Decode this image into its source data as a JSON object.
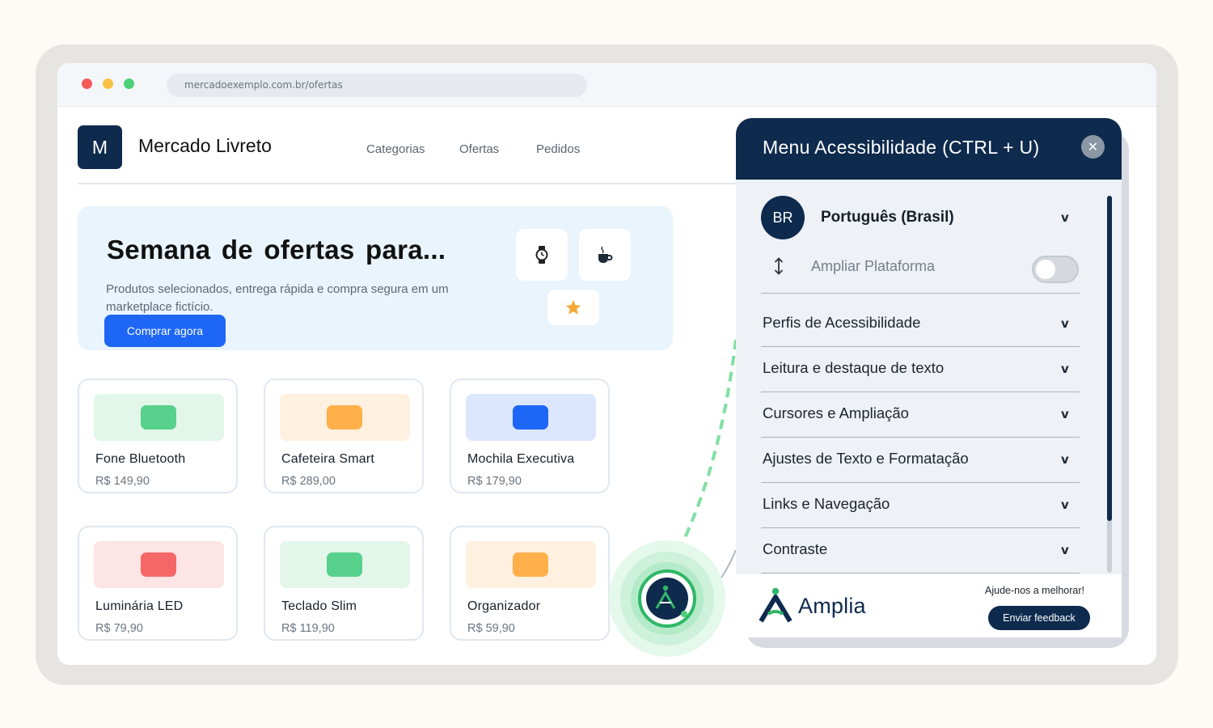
{
  "browser": {
    "url": "mercadoexemplo.com.br/ofertas"
  },
  "site": {
    "logo_letter": "M",
    "brand_name": "Mercado Livreto",
    "nav": [
      "Categorias",
      "Ofertas",
      "Pedidos"
    ]
  },
  "hero": {
    "title": "Semana de ofertas para...",
    "subtitle": "Produtos selecionados, entrega rápida e compra segura em um marketplace fictício.",
    "cta_label": "Comprar agora",
    "tiles": [
      "watch-icon",
      "coffee-icon",
      "star-icon"
    ]
  },
  "products": [
    {
      "name": "Fone Bluetooth",
      "price": "R$ 149,90",
      "thumb_color": "#e2f6ea",
      "chip_color": "#57d18c"
    },
    {
      "name": "Cafeteira Smart",
      "price": "R$ 289,00",
      "thumb_color": "#fff0df",
      "chip_color": "#ffb04a"
    },
    {
      "name": "Mochila Executiva",
      "price": "R$ 179,90",
      "thumb_color": "#dce7fd",
      "chip_color": "#1e66f5"
    },
    {
      "name": "Luminária LED",
      "price": "R$ 79,90",
      "thumb_color": "#fde4e5",
      "chip_color": "#f56666"
    },
    {
      "name": "Teclado Slim",
      "price": "R$ 119,90",
      "thumb_color": "#e2f6ea",
      "chip_color": "#57d18c"
    },
    {
      "name": "Organizador",
      "price": "R$ 59,90",
      "thumb_color": "#fff0df",
      "chip_color": "#ffb04a"
    }
  ],
  "accessibility_panel": {
    "title": "Menu Acessibilidade (CTRL + U)",
    "close_icon": "close-icon",
    "language_code": "BR",
    "language_label": "Português (Brasil)",
    "enlarge_label": "Ampliar Plataforma",
    "enlarge_enabled": false,
    "sections": [
      "Perfis de Acessibilidade",
      "Leitura e destaque de texto",
      "Cursores e Ampliação",
      "Ajustes de Texto e Formatação",
      "Links e Navegação",
      "Contraste"
    ],
    "chevron_glyph": "v",
    "footer": {
      "logo_text": "Amplia",
      "help_text": "Ajude-nos a melhorar!",
      "feedback_label": "Enviar feedback"
    }
  },
  "colors": {
    "navy": "#0e2a4d",
    "primary_blue": "#1e66f5",
    "launcher_green": "#4cd07a"
  }
}
